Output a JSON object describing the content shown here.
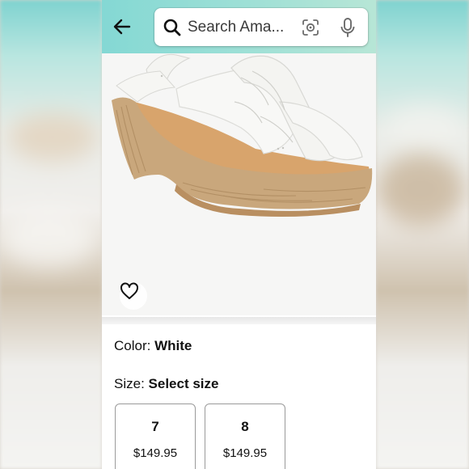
{
  "header": {
    "back_icon": "arrow-left-icon",
    "search": {
      "placeholder": "Search Ama...",
      "search_icon": "search-icon",
      "camera_icon": "camera-lens-icon",
      "mic_icon": "microphone-icon"
    }
  },
  "product": {
    "image_desc_icon": "wishlist-heart-icon",
    "color_label": "Color:",
    "color_value": "White",
    "size_label": "Size:",
    "size_value": "Select size",
    "sizes": [
      {
        "size": "7",
        "price": "$149.95"
      },
      {
        "size": "8",
        "price": "$149.95"
      }
    ]
  },
  "colors": {
    "topbar": "#84d8d4",
    "sandal_white": "#f7f7f5",
    "wedge_cork": "#c9a77c",
    "footbed_tan": "#d9a672"
  }
}
